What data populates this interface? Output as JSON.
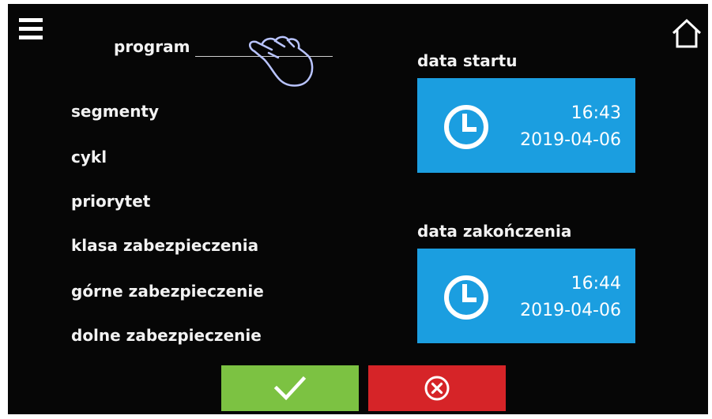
{
  "header": {
    "menu_icon": "hamburger-menu-icon",
    "home_icon": "home-icon"
  },
  "program": {
    "label": "program",
    "value": ""
  },
  "fields": [
    {
      "label": "segmenty"
    },
    {
      "label": "cykl"
    },
    {
      "label": "priorytet"
    },
    {
      "label": "klasa zabezpieczenia"
    },
    {
      "label": "górne zabezpieczenie"
    },
    {
      "label": "dolne zabezpieczenie"
    }
  ],
  "start": {
    "caption": "data startu",
    "time": "16:43",
    "date": "2019-04-06"
  },
  "end": {
    "caption": "data zakończenia",
    "time": "16:44",
    "date": "2019-04-06"
  },
  "footer": {
    "confirm_icon": "checkmark-icon",
    "cancel_icon": "circle-x-icon"
  },
  "colors": {
    "background": "#060606",
    "date_box": "#1b9ee0",
    "confirm": "#7cc242",
    "cancel": "#d62428"
  }
}
